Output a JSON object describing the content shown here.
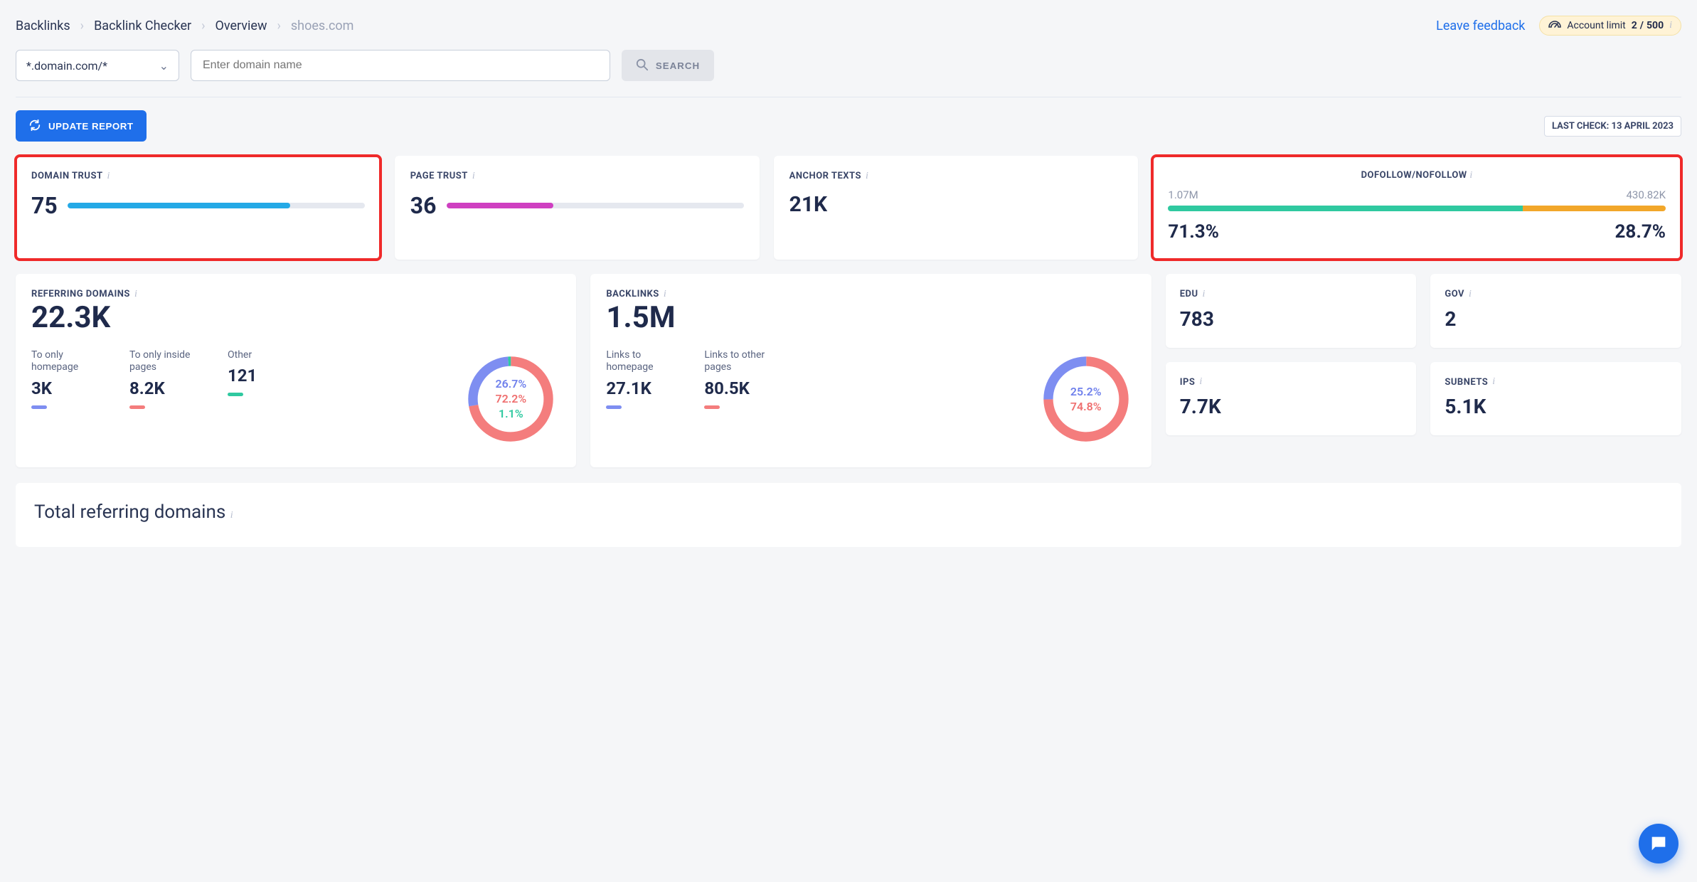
{
  "breadcrumb": {
    "items": [
      "Backlinks",
      "Backlink Checker",
      "Overview"
    ],
    "current": "shoes.com"
  },
  "feedback_label": "Leave feedback",
  "account_limit": {
    "label": "Account limit",
    "used": "2",
    "total": "500"
  },
  "selector_value": "*.domain.com/*",
  "domain_placeholder": "Enter domain name",
  "search_label": "SEARCH",
  "update_label": "UPDATE REPORT",
  "last_check": {
    "prefix": "LAST CHECK:",
    "value": "13 APRIL 2023"
  },
  "cards": {
    "domain_trust": {
      "title": "DOMAIN TRUST",
      "value": "75"
    },
    "page_trust": {
      "title": "PAGE TRUST",
      "value": "36"
    },
    "anchor_texts": {
      "title": "ANCHOR TEXTS",
      "value": "21K"
    },
    "df": {
      "title": "DOFOLLOW/NOFOLLOW",
      "left_count": "1.07M",
      "right_count": "430.82K",
      "left_pct": "71.3%",
      "right_pct": "28.7%"
    }
  },
  "ref_domains": {
    "title": "REFERRING DOMAINS",
    "total": "22.3K",
    "subs": [
      {
        "label": "To only homepage",
        "value": "3K"
      },
      {
        "label": "To only inside pages",
        "value": "8.2K"
      },
      {
        "label": "Other",
        "value": "121"
      }
    ],
    "donut": {
      "blue": "26.7%",
      "red": "72.2%",
      "green": "1.1%"
    }
  },
  "backlinks": {
    "title": "BACKLINKS",
    "total": "1.5M",
    "subs": [
      {
        "label": "Links to homepage",
        "value": "27.1K"
      },
      {
        "label": "Links to other pages",
        "value": "80.5K"
      }
    ],
    "donut": {
      "blue": "25.2%",
      "red": "74.8%"
    }
  },
  "side": {
    "edu": {
      "title": "EDU",
      "value": "783"
    },
    "gov": {
      "title": "GOV",
      "value": "2"
    },
    "ips": {
      "title": "IPS",
      "value": "7.7K"
    },
    "subnets": {
      "title": "SUBNETS",
      "value": "5.1K"
    }
  },
  "bottom_title": "Total referring domains",
  "chart_data": [
    {
      "type": "bar",
      "title": "Domain Trust",
      "categories": [
        "Domain Trust"
      ],
      "values": [
        75
      ],
      "ylim": [
        0,
        100
      ]
    },
    {
      "type": "bar",
      "title": "Page Trust",
      "categories": [
        "Page Trust"
      ],
      "values": [
        36
      ],
      "ylim": [
        0,
        100
      ]
    },
    {
      "type": "bar",
      "title": "Dofollow vs Nofollow (counts)",
      "categories": [
        "Dofollow",
        "Nofollow"
      ],
      "values": [
        1070000,
        430820
      ],
      "series": [
        {
          "name": "Dofollow",
          "values": [
            71.3
          ]
        },
        {
          "name": "Nofollow",
          "values": [
            28.7
          ]
        }
      ]
    },
    {
      "type": "pie",
      "title": "Referring domains by destination",
      "categories": [
        "To only homepage",
        "To only inside pages",
        "Other"
      ],
      "values": [
        26.7,
        72.2,
        1.1
      ]
    },
    {
      "type": "pie",
      "title": "Backlinks by destination",
      "categories": [
        "Links to homepage",
        "Links to other pages"
      ],
      "values": [
        25.2,
        74.8
      ]
    }
  ]
}
